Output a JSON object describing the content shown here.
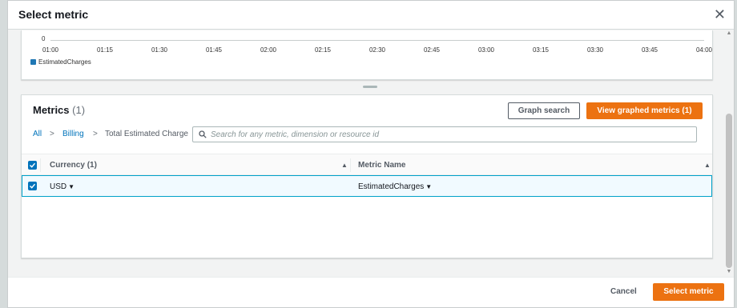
{
  "modal": {
    "title": "Select metric",
    "close_icon": "close-icon"
  },
  "graph": {
    "y_zero": "0",
    "x_ticks": [
      "01:00",
      "01:15",
      "01:30",
      "01:45",
      "02:00",
      "02:15",
      "02:30",
      "02:45",
      "03:00",
      "03:15",
      "03:30",
      "03:45",
      "04:00"
    ],
    "legend_label": "EstimatedCharges",
    "legend_color": "#1f77b4"
  },
  "metrics": {
    "title": "Metrics",
    "count": "(1)",
    "graph_search_label": "Graph search",
    "view_graphed_label": "View graphed metrics (1)",
    "breadcrumb": {
      "all": "All",
      "sep": ">",
      "billing": "Billing",
      "current": "Total Estimated Charge"
    },
    "search_placeholder": "Search for any metric, dimension or resource id",
    "table": {
      "col_currency": "Currency",
      "col_currency_count": "(1)",
      "col_metric_name": "Metric Name",
      "rows": [
        {
          "currency": "USD",
          "metric_name": "EstimatedCharges",
          "selected": true
        }
      ]
    }
  },
  "footer": {
    "cancel_label": "Cancel",
    "select_label": "Select metric"
  },
  "colors": {
    "accent": "#ec7211",
    "link": "#0073bb",
    "checkbox": "#0073bb",
    "selected_row_border": "#00a1c9"
  }
}
